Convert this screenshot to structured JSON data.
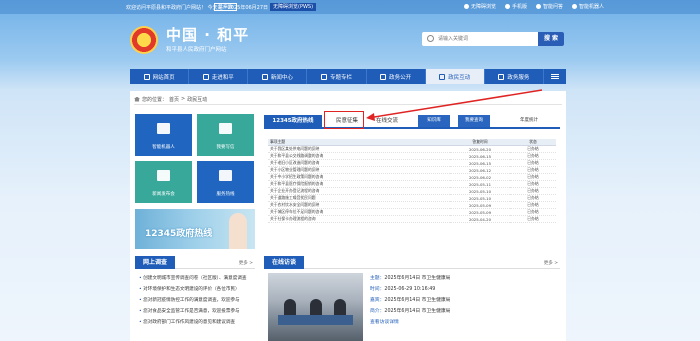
{
  "topbar": {
    "welcome": "欢迎访问平原县和平政府门户网站！ 今天是：2025年06月27日 星期五",
    "elder_mode": "长辈版",
    "accessibility": "无障碍浏览(PWS)",
    "links": [
      "无障碍浏览",
      "手机版",
      "智能问答",
      "智能机器人"
    ]
  },
  "header": {
    "title": "中国 · 和平",
    "subtitle": "和平县人民政府门户网站",
    "search_placeholder": "请输入关键词",
    "search_button": "搜 索"
  },
  "nav": {
    "items": [
      {
        "label": "网站首页",
        "icon": "home-icon",
        "active": false
      },
      {
        "label": "走进和平",
        "icon": "building-icon",
        "active": false
      },
      {
        "label": "新闻中心",
        "icon": "news-icon",
        "active": false
      },
      {
        "label": "专题专栏",
        "icon": "flag-icon",
        "active": false
      },
      {
        "label": "政务公开",
        "icon": "doc-icon",
        "active": false
      },
      {
        "label": "政民互动",
        "icon": "book-icon",
        "active": true
      },
      {
        "label": "政务服务",
        "icon": "service-icon",
        "active": false
      }
    ]
  },
  "breadcrumb": {
    "prefix": "您的位置：",
    "home": "首页",
    "sep": ">",
    "current": "政民互动"
  },
  "tiles": [
    {
      "label": "智能机器人",
      "icon": "bell-icon"
    },
    {
      "label": "我要写信",
      "icon": "letter-icon"
    },
    {
      "label": "新闻发布会",
      "icon": "calendar-icon"
    },
    {
      "label": "服务热线",
      "icon": "phone-icon"
    }
  ],
  "banner": {
    "text": "12345政府热线"
  },
  "hotline": {
    "tab_title": "12345政府热线",
    "tab_solicit": "民意征集",
    "tab_online": "在线交流",
    "btn_know": "知识库",
    "btn_query": "我要查询",
    "annual": "年度统计",
    "columns": [
      "事项主题",
      "答复时间",
      "状态"
    ],
    "rows": [
      {
        "title": "关于我区某处供电问题的反映",
        "date": "2025-06-20",
        "status": "已办结"
      },
      {
        "title": "关于和平县公交线路调整的咨询",
        "date": "2025-06-15",
        "status": "已办结"
      },
      {
        "title": "关于老旧小区改造问题的咨询",
        "date": "2025-06-15",
        "status": "已办结"
      },
      {
        "title": "关于小区物业管理问题的反映",
        "date": "2025-06-12",
        "status": "已办结"
      },
      {
        "title": "关于中小学招生政策问题的咨询",
        "date": "2025-06-02",
        "status": "已办结"
      },
      {
        "title": "关于和平县医疗保险报销的咨询",
        "date": "2025-05-11",
        "status": "已办结"
      },
      {
        "title": "关于企业开办登记流程的咨询",
        "date": "2025-05-10",
        "status": "已办结"
      },
      {
        "title": "关于道路施工噪音扰民问题",
        "date": "2025-05-10",
        "status": "已办结"
      },
      {
        "title": "关于农村饮水安全问题的反映",
        "date": "2025-05-09",
        "status": "已办结"
      },
      {
        "title": "关于城区停车位不足问题的咨询",
        "date": "2025-05-09",
        "status": "已办结"
      },
      {
        "title": "关于社保卡办理流程的咨询",
        "date": "2025-04-20",
        "status": "已办结"
      }
    ]
  },
  "survey": {
    "title": "网上调查",
    "more": "更多 >",
    "items": [
      "创建文明城市宣传调查问卷（社区版）、满意度调查",
      "对环境保护和生态文明建设的评价（各位市民）",
      "您对新冠疫情防控工作的满意度调查，欢迎参与",
      "您对食品安全监管工作是否满意，欢迎投票参与",
      "您对政府部门工作作风建设的意见和建议调查"
    ]
  },
  "interview": {
    "title": "在线访谈",
    "more": "更多 >",
    "fields": [
      {
        "key": "主题：",
        "value": "2025年6月14日 市卫生健康局"
      },
      {
        "key": "时间：",
        "value": "2025-06-29 10:16:49"
      },
      {
        "key": "嘉宾：",
        "value": "2025年6月14日 市卫生健康局"
      },
      {
        "key": "简介：",
        "value": "2025年6月14日 市卫生健康局"
      }
    ],
    "detail_link": "查看访谈详情"
  }
}
